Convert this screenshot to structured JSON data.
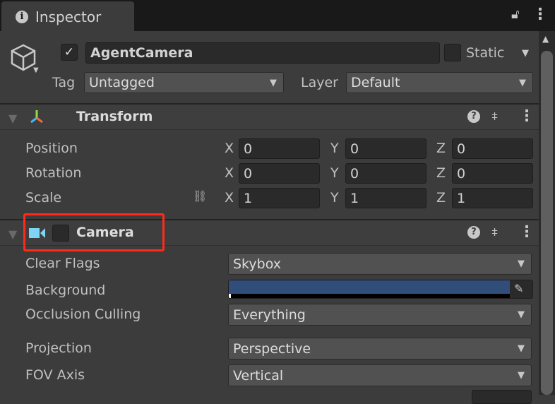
{
  "tab": {
    "title": "Inspector"
  },
  "object": {
    "name": "AgentCamera",
    "active": true,
    "static_label": "Static",
    "tag_label": "Tag",
    "tag_value": "Untagged",
    "layer_label": "Layer",
    "layer_value": "Default"
  },
  "transform": {
    "title": "Transform",
    "axes": [
      "X",
      "Y",
      "Z"
    ],
    "rows": [
      {
        "label": "Position",
        "values": [
          "0",
          "0",
          "0"
        ]
      },
      {
        "label": "Rotation",
        "values": [
          "0",
          "0",
          "0"
        ]
      },
      {
        "label": "Scale",
        "values": [
          "1",
          "1",
          "1"
        ]
      }
    ]
  },
  "camera": {
    "title": "Camera",
    "enabled": false,
    "fields": {
      "clear_flags": {
        "label": "Clear Flags",
        "value": "Skybox"
      },
      "background": {
        "label": "Background",
        "color": "#314d79"
      },
      "occlusion": {
        "label": "Occlusion Culling",
        "value": "Everything"
      },
      "projection": {
        "label": "Projection",
        "value": "Perspective"
      },
      "fov_axis": {
        "label": "FOV Axis",
        "value": "Vertical"
      }
    }
  },
  "colors": {
    "highlight": "#ff2a1a",
    "camera_icon": "#7fd3f7"
  }
}
